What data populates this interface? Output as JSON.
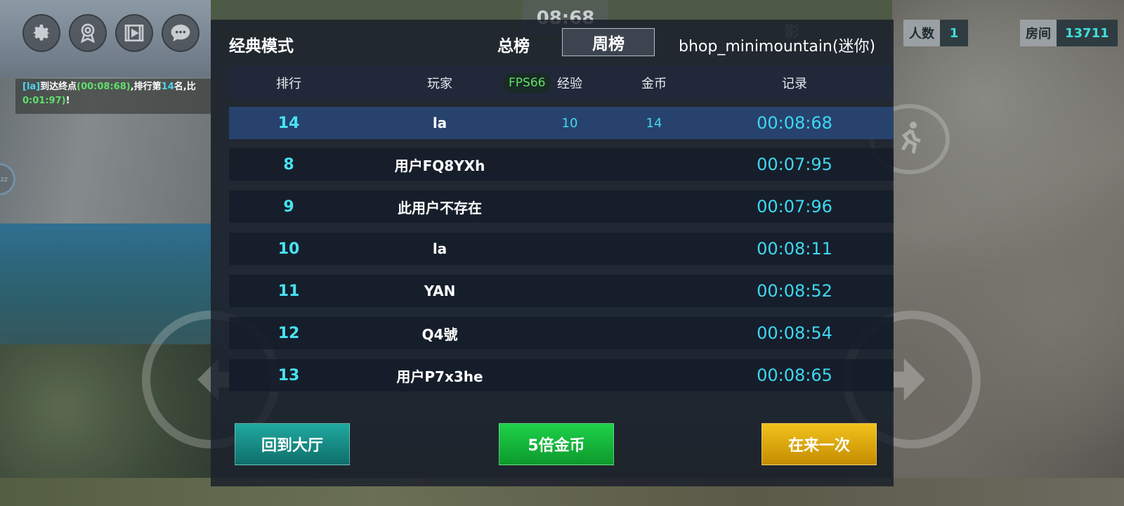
{
  "hud": {
    "icons": [
      "gear-icon",
      "award-icon",
      "video-icon",
      "chat-icon"
    ],
    "timer": "08:68",
    "chat": {
      "player": "[la]",
      "msg1": "到达终点",
      "time": "(00:08:68)",
      "msg2": ",排行第",
      "rank": "14",
      "msg3": "名,比",
      "diff": "0:01:97)",
      "end": "!"
    },
    "side_badge": "zz",
    "players_label": "人数",
    "players_value": "1",
    "room_label": "房间",
    "room_value": "13711",
    "view_label": "影"
  },
  "panel": {
    "mode": "经典模式",
    "tab_total": "总榜",
    "tab_week": "周榜",
    "map": "bhop_minimountain(迷你)",
    "headers": {
      "rank": "排行",
      "player": "玩家",
      "fps": "FPS66",
      "exp": "经验",
      "coin": "金币",
      "record": "记录"
    },
    "rows": [
      {
        "rank": "14",
        "player": "la",
        "exp": "10",
        "coin": "14",
        "record": "00:08:68"
      },
      {
        "rank": "8",
        "player": "用户FQ8YXh",
        "exp": "",
        "coin": "",
        "record": "00:07:95"
      },
      {
        "rank": "9",
        "player": "此用户不存在",
        "exp": "",
        "coin": "",
        "record": "00:07:96"
      },
      {
        "rank": "10",
        "player": "la",
        "exp": "",
        "coin": "",
        "record": "00:08:11"
      },
      {
        "rank": "11",
        "player": "YAN",
        "exp": "",
        "coin": "",
        "record": "00:08:52"
      },
      {
        "rank": "12",
        "player": "Q4號",
        "exp": "",
        "coin": "",
        "record": "00:08:54"
      },
      {
        "rank": "13",
        "player": "用户P7x3he",
        "exp": "",
        "coin": "",
        "record": "00:08:65"
      }
    ],
    "buttons": {
      "lobby": "回到大厅",
      "coins": "5倍金币",
      "again": "在来一次"
    }
  },
  "colors": {
    "accent_cyan": "#3ed8f0",
    "fps_green": "#5fe06a",
    "btn_teal": "#1fa9a0",
    "btn_green": "#1fd14a",
    "btn_yellow": "#f0c21c"
  }
}
